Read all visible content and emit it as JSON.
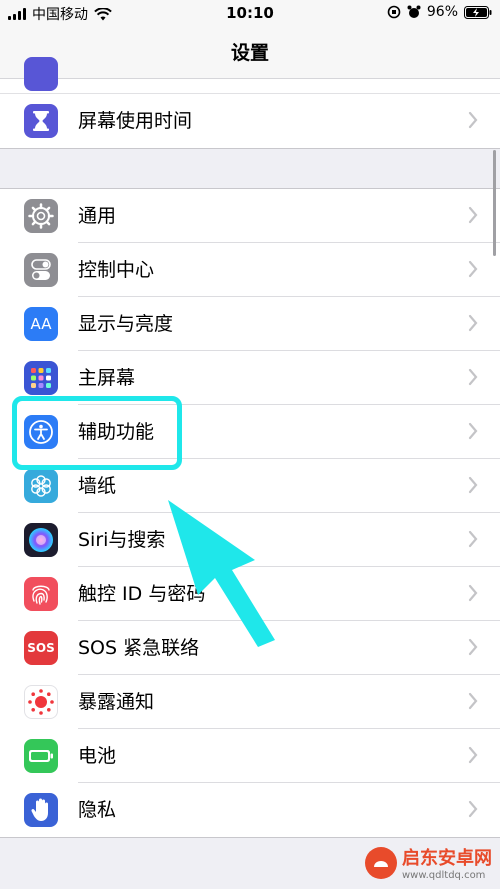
{
  "status_bar": {
    "carrier": "中国移动",
    "time": "10:10",
    "battery": "96%"
  },
  "nav": {
    "title": "设置"
  },
  "top_group": {
    "items": [
      {
        "label": "屏幕使用时间",
        "icon": "hourglass-icon",
        "color": "#5856d6"
      }
    ]
  },
  "main_group": {
    "items": [
      {
        "label": "通用",
        "icon": "gear-icon",
        "color": "#8e8e93"
      },
      {
        "label": "控制中心",
        "icon": "toggle-icon",
        "color": "#8e8e93"
      },
      {
        "label": "显示与亮度",
        "icon": "text-size-icon",
        "color": "#2c7cf6",
        "icon_text": "AA"
      },
      {
        "label": "主屏幕",
        "icon": "app-grid-icon",
        "color": "#3a55d4"
      },
      {
        "label": "辅助功能",
        "icon": "accessibility-icon",
        "color": "#2c7cf6"
      },
      {
        "label": "墙纸",
        "icon": "flower-icon",
        "color": "#36aadc"
      },
      {
        "label": "Siri与搜索",
        "icon": "siri-icon",
        "color": "#1c1c2e"
      },
      {
        "label": "触控 ID 与密码",
        "icon": "fingerprint-icon",
        "color": "#f14e5d"
      },
      {
        "label": "SOS 紧急联络",
        "icon": "sos-icon",
        "color": "#e3393c",
        "icon_text": "SOS"
      },
      {
        "label": "暴露通知",
        "icon": "exposure-icon",
        "color": "#ffffff"
      },
      {
        "label": "电池",
        "icon": "battery-icon",
        "color": "#34c759"
      },
      {
        "label": "隐私",
        "icon": "hand-icon",
        "color": "#3a62d6"
      }
    ]
  },
  "watermark": {
    "title": "启东安卓网",
    "url": "www.qdltdq.com"
  },
  "annotation": {
    "highlight_color": "#1fe7ea"
  }
}
